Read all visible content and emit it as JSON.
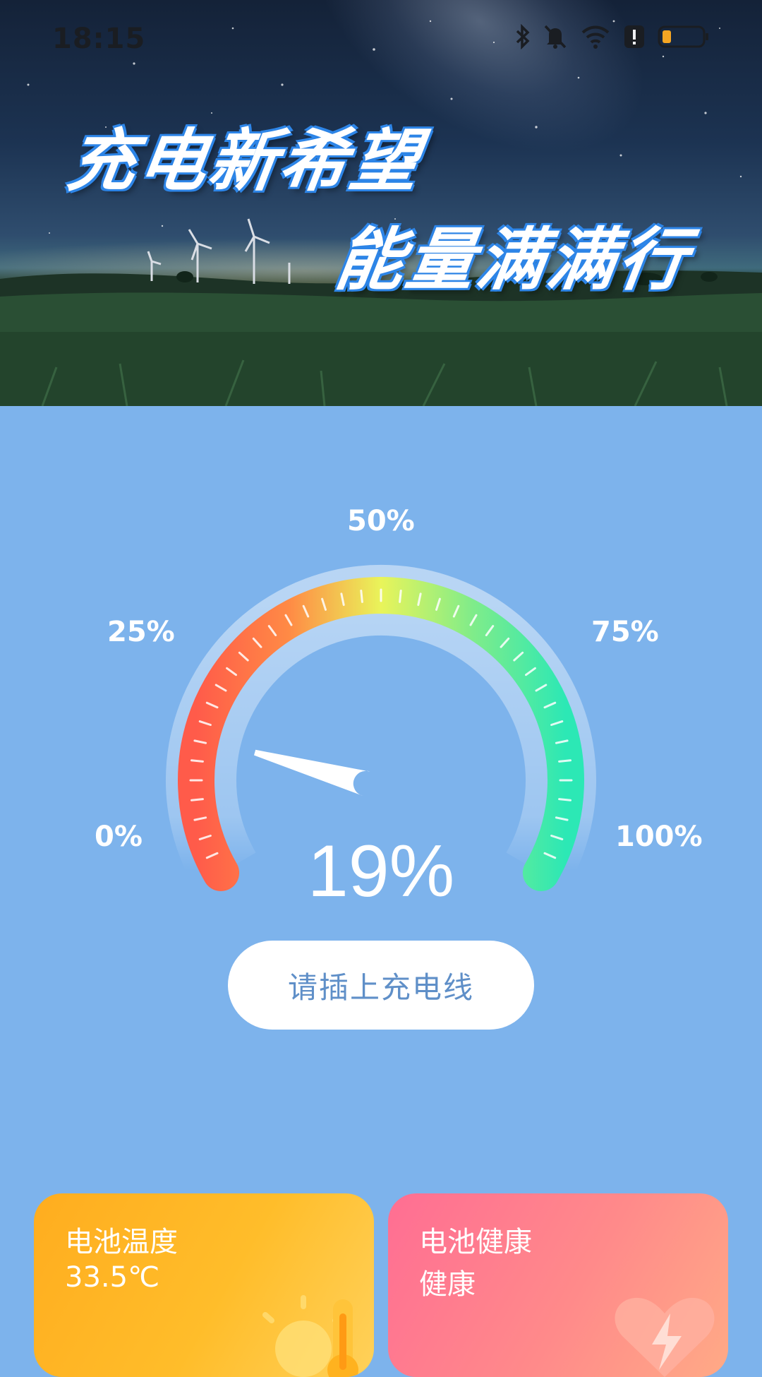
{
  "status_bar": {
    "time": "18:15",
    "icons": [
      "bluetooth-icon",
      "mute-icon",
      "wifi-icon",
      "alert-icon",
      "battery-icon"
    ]
  },
  "hero": {
    "line1": "充电新希望",
    "line2": "能量满满行"
  },
  "gauge": {
    "labels": {
      "p0": "0%",
      "p25": "25%",
      "p50": "50%",
      "p75": "75%",
      "p100": "100%"
    },
    "level": 0.19,
    "percent_text": "19%",
    "colors": {
      "low": "#ff5b4a",
      "mid": "#e9f45a",
      "high": "#2ce8b5"
    }
  },
  "charge_button": {
    "label": "请插上充电线"
  },
  "cards": {
    "temperature": {
      "title": "电池温度",
      "value": "33.5℃"
    },
    "health": {
      "title": "电池健康",
      "value": "健康"
    }
  }
}
